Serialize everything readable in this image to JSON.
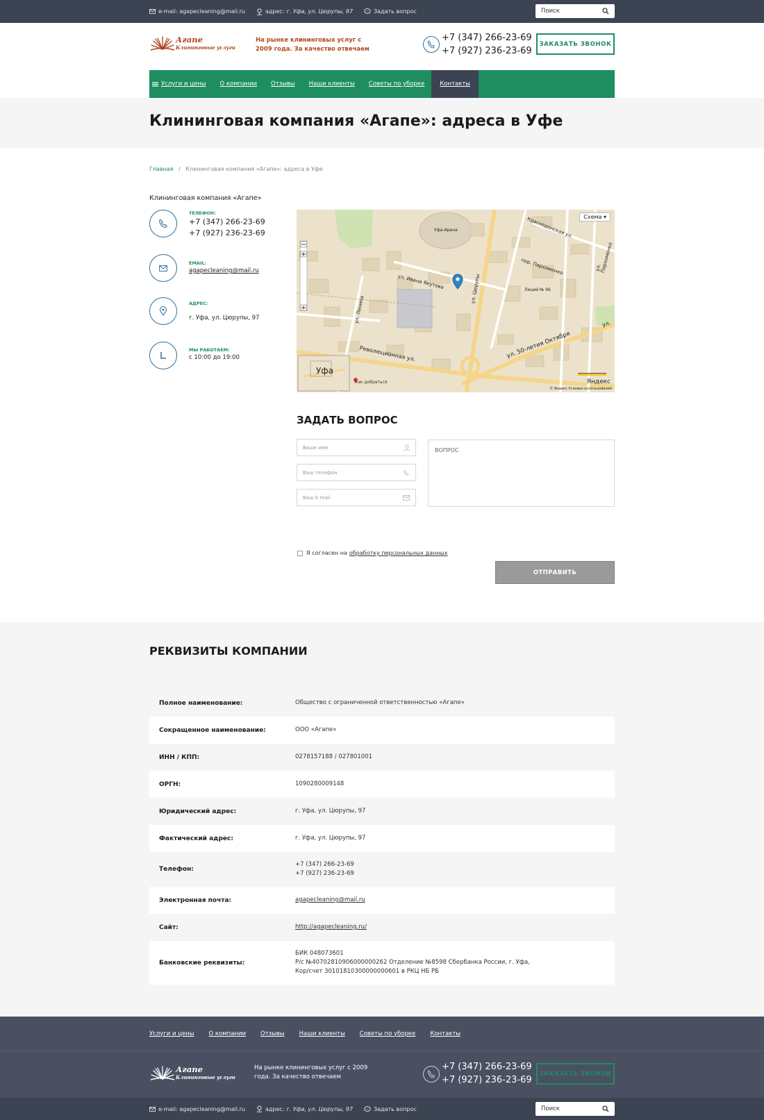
{
  "topbar": {
    "email": "e-mail: agapecleaning@mail.ru",
    "address_prefix": "адрес:",
    "address": "г. Уфа, ул. Цюрупы, 97",
    "ask": "Задать вопрос",
    "search_placeholder": "Поиск"
  },
  "header": {
    "logo_title": "Агапе",
    "logo_subtitle": "Клининговые услуги",
    "tagline": "На рынке клининговых услуг с 2009 года. За качество отвечаем",
    "phone1": "+7 (347) 266-23-69",
    "phone2": "+7 (927) 236-23-69",
    "callback": "ЗАКАЗАТЬ ЗВОНОК"
  },
  "nav": {
    "items": [
      "Услуги и цены",
      "О компании",
      "Отзывы",
      "Наши клиенты",
      "Советы по уборке",
      "Контакты"
    ],
    "active_index": 5
  },
  "page": {
    "title": "Клининговая компания «Агапе»: адреса в Уфе",
    "breadcrumb_home": "Главная",
    "breadcrumb_sep": "/",
    "breadcrumb_current": "Клининговая компания «Агапе»: адреса в Уфе"
  },
  "contacts": {
    "company": "Клининговая компания «Агапе»",
    "phone_label": "ТЕЛЕФОН:",
    "phone1": "+7 (347) 266-23-69",
    "phone2": "+7 (927) 236-23-69",
    "email_label": "EMAIL:",
    "email": "agapecleaning@mail.ru",
    "address_label": "АДРЕС:",
    "address": "г. Уфа, ул. Цюрупы, 97",
    "hours_label": "МЫ РАБОТАЕМ:",
    "hours": "с 10:00 до 19:00"
  },
  "map": {
    "scheme": "Схема ▾",
    "city": "Уфа",
    "route": "Как добраться",
    "provider": "Яндекс",
    "footnote": "© Яндекс  Условия использования",
    "streets": [
      "ул. Ивана Якутова",
      "ул. Ленина",
      "ул. Цюрупы",
      "ул. 50-летия Октября",
      "Революционная ул.",
      "Краснодонская ул.",
      "пер. Пархоменко",
      "Уфа-Арена",
      "Лицей № 96",
      "ул. Пархоменко",
      "ул."
    ]
  },
  "question": {
    "title": "ЗАДАТЬ ВОПРОС",
    "name_placeholder": "Ваше имя",
    "phone_placeholder": "Ваш телефон",
    "email_placeholder": "Ваш E-mail",
    "question_placeholder": "ВОПРОС",
    "agree_text": "Я согласен на",
    "agree_link": "обработку персональных данных",
    "submit": "ОТПРАВИТЬ"
  },
  "requisites": {
    "title": "РЕКВИЗИТЫ КОМПАНИИ",
    "rows": [
      {
        "key": "Полное наименование:",
        "lines": [
          "Общество с ограниченной ответственностью «Агапе»"
        ]
      },
      {
        "key": "Сокращенное наименование:",
        "lines": [
          "ООО «Агапе»"
        ]
      },
      {
        "key": "ИНН / КПП:",
        "lines": [
          "0278157188 / 027801001"
        ]
      },
      {
        "key": "ОРГН:",
        "lines": [
          "1090280009148"
        ]
      },
      {
        "key": "Юридический адрес:",
        "lines": [
          "г. Уфа, ул. Цюрупы, 97"
        ]
      },
      {
        "key": "Фактический адрес:",
        "lines": [
          "г. Уфа, ул. Цюрупы, 97"
        ]
      },
      {
        "key": "Телефон:",
        "lines": [
          "+7 (347) 266-23-69",
          "+7 (927) 236-23-69"
        ]
      },
      {
        "key": "Электронная почта:",
        "lines": [
          "agapecleaning@mail.ru"
        ]
      },
      {
        "key": "Сайт:",
        "lines": [
          "http://agapecleaning.ru/"
        ]
      },
      {
        "key": "Банковские реквизиты:",
        "lines": [
          "БИК 048073601",
          "Р/с №40702810906000000262 Отделение №8598 Сбербанка России, г. Уфа,",
          "Кор/счет 30101810300000000601 в РКЦ НБ РБ"
        ]
      }
    ]
  },
  "footer": {
    "nav": [
      "Услуги и цены",
      "О компании",
      "Отзывы",
      "Наши клиенты",
      "Советы по уборке",
      "Контакты"
    ],
    "tagline": "На рынке клининговых услуг с 2009 года. За качество отвечаем"
  },
  "colors": {
    "brand_green": "#1e8d60",
    "dark_bar": "#3c4352",
    "logo_red": "#b0401f",
    "icon_blue": "#2e6e9c"
  }
}
